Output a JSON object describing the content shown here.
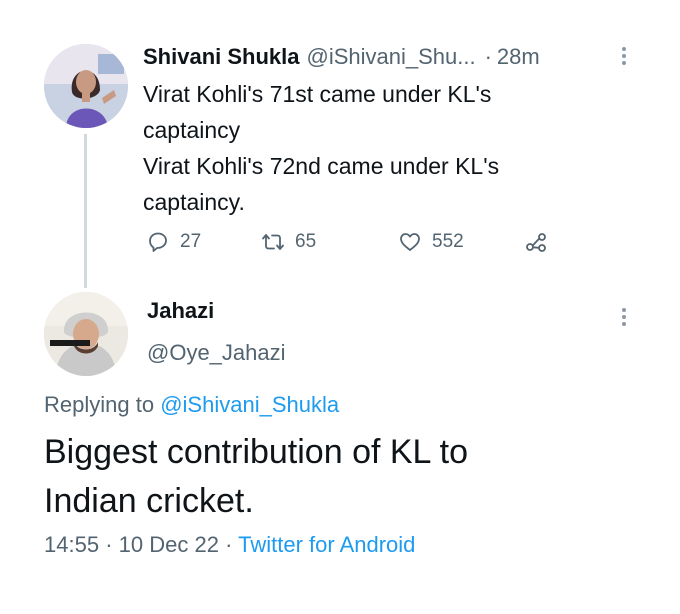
{
  "tweet1": {
    "author_name": "Shivani Shukla",
    "author_handle": "@iShivani_Shu...",
    "separator": "·",
    "time": "28m",
    "text_lines": [
      "Virat Kohli's 71st came under KL's",
      "captaincy",
      "Virat Kohli's 72nd came under KL's",
      "captaincy."
    ],
    "replies": "27",
    "retweets": "65",
    "likes": "552"
  },
  "tweet2": {
    "author_name": "Jahazi",
    "author_handle": "@Oye_Jahazi",
    "replying_prefix": "Replying to",
    "replying_to": "@iShivani_Shukla",
    "text_lines": [
      "Biggest contribution of KL to",
      "Indian cricket."
    ],
    "time": "14:55",
    "separator1": "·",
    "date": "10 Dec 22",
    "separator2": "·",
    "source": "Twitter for Android"
  },
  "icons": {
    "reply": "reply-icon",
    "retweet": "retweet-icon",
    "like": "heart-icon",
    "share": "share-icon",
    "more": "more-icon"
  },
  "colors": {
    "text": "#0f1419",
    "secondary": "#536471",
    "link": "#1d9bf0",
    "thread_line": "#cfd9de"
  }
}
